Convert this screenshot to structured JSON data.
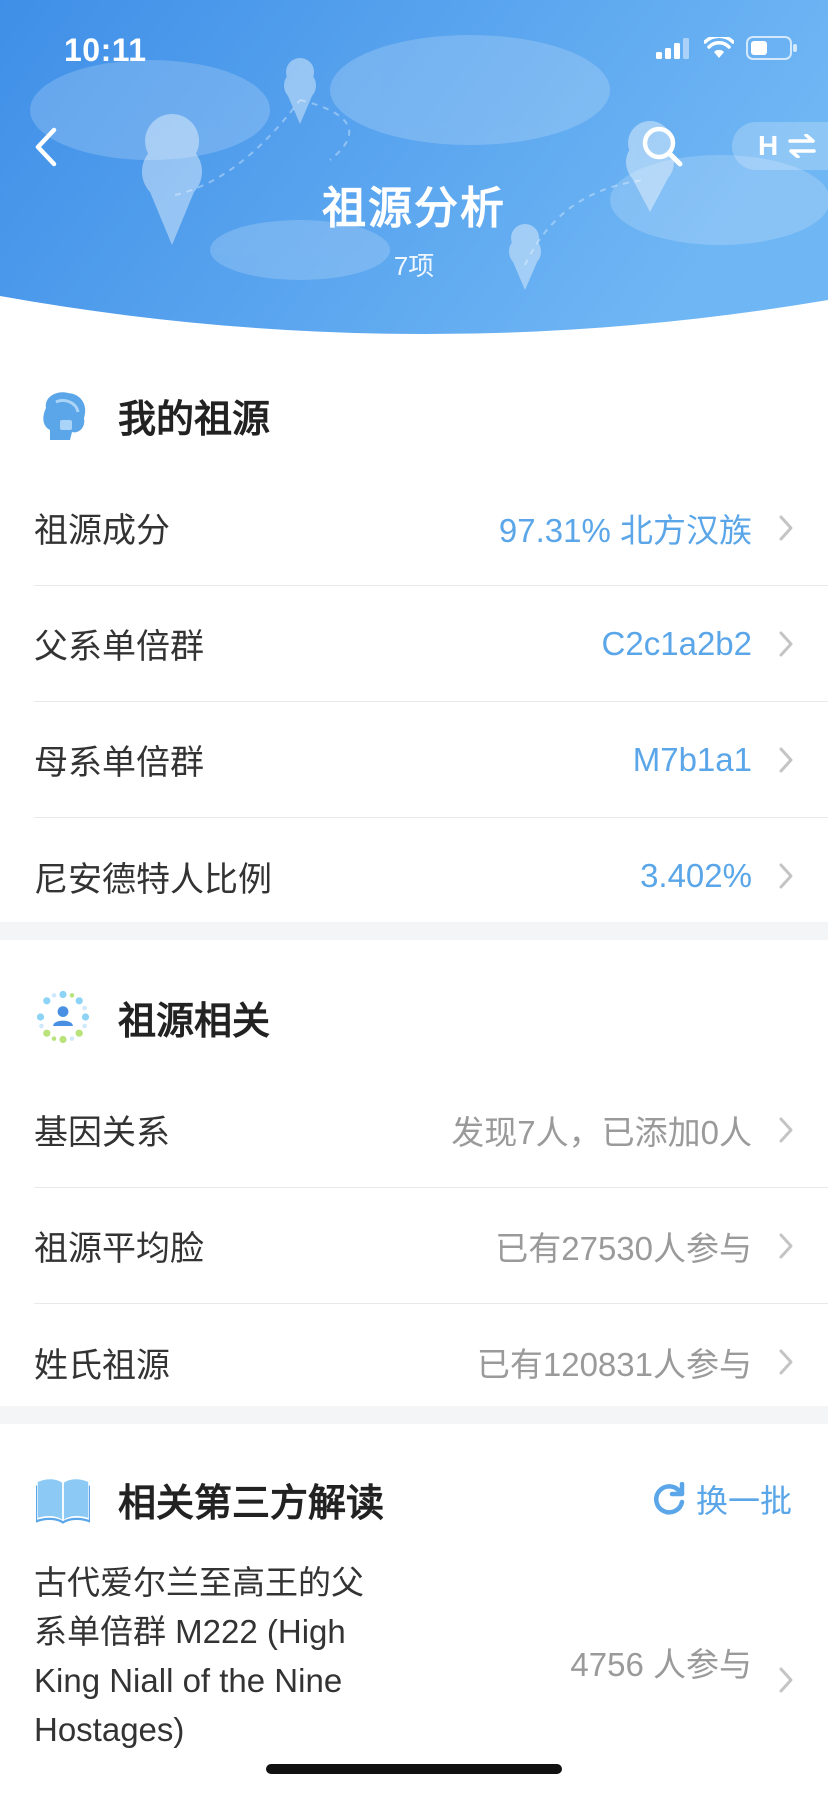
{
  "status_bar": {
    "time": "10:11"
  },
  "header": {
    "title": "祖源分析",
    "subtitle": "7项",
    "switch_label": "H"
  },
  "sections": {
    "my_ancestry": {
      "title": "我的祖源",
      "rows": [
        {
          "label": "祖源成分",
          "value": "97.31% 北方汉族"
        },
        {
          "label": "父系单倍群",
          "value": "C2c1a2b2"
        },
        {
          "label": "母系单倍群",
          "value": "M7b1a1"
        },
        {
          "label": "尼安德特人比例",
          "value": "3.402%"
        }
      ]
    },
    "related": {
      "title": "祖源相关",
      "rows": [
        {
          "label": "基因关系",
          "value": "发现7人，已添加0人"
        },
        {
          "label": "祖源平均脸",
          "value": "已有27530人参与"
        },
        {
          "label": "姓氏祖源",
          "value": "已有120831人参与"
        }
      ]
    },
    "third_party": {
      "title": "相关第三方解读",
      "refresh_label": "换一批",
      "articles": [
        {
          "title_lines": [
            "古代爱尔兰至高王的父",
            "系单倍群 M222 (High",
            "King Niall of the Nine",
            "Hostages)"
          ],
          "participants": "4756 人参与"
        }
      ]
    }
  },
  "colors": {
    "header_gradient_start": "#3f8fe8",
    "header_gradient_end": "#6fb6f4",
    "accent_blue": "#5aa6e8",
    "secondary_text": "#9a9a9a",
    "section_gap": "#f4f5f7"
  },
  "icons": [
    "back-icon",
    "search-icon",
    "swap-icon",
    "signal-icon",
    "wifi-icon",
    "battery-icon",
    "ancestry-head-icon",
    "people-network-icon",
    "book-icon",
    "refresh-icon",
    "chevron-right-icon"
  ]
}
